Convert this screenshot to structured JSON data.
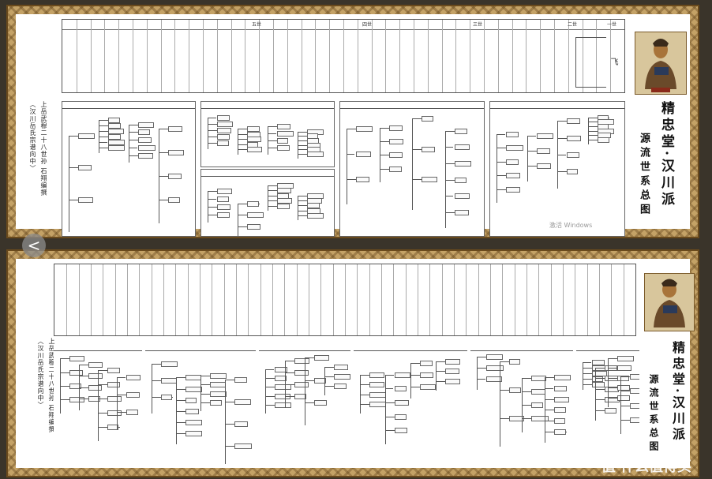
{
  "scroll_top": {
    "title_line1": "精忠堂·汉川派",
    "title_line2": "源流世系总图",
    "left_note_col1": "〈汉川岳氏宗谱向中〉",
    "left_note_col2": "上岳武穆二十八世孙 石翔编撰",
    "watermark": "激活 Windows",
    "header_small": "飞",
    "gen_labels": [
      "五世",
      "四世",
      "三世",
      "二世",
      "一世"
    ],
    "table_side_labels": [
      "岳",
      "飞"
    ]
  },
  "scroll_bottom": {
    "title_line1": "精忠堂·汉川派",
    "title_line2": "源流世系总图",
    "left_note_col1": "〈汉川岳氏宗谱向中〉",
    "left_note_col2": "上岳武穆二十八世孙 石翔编撰"
  },
  "nav": {
    "prev_label": "<"
  },
  "corner_watermark": "值 什么值得买"
}
